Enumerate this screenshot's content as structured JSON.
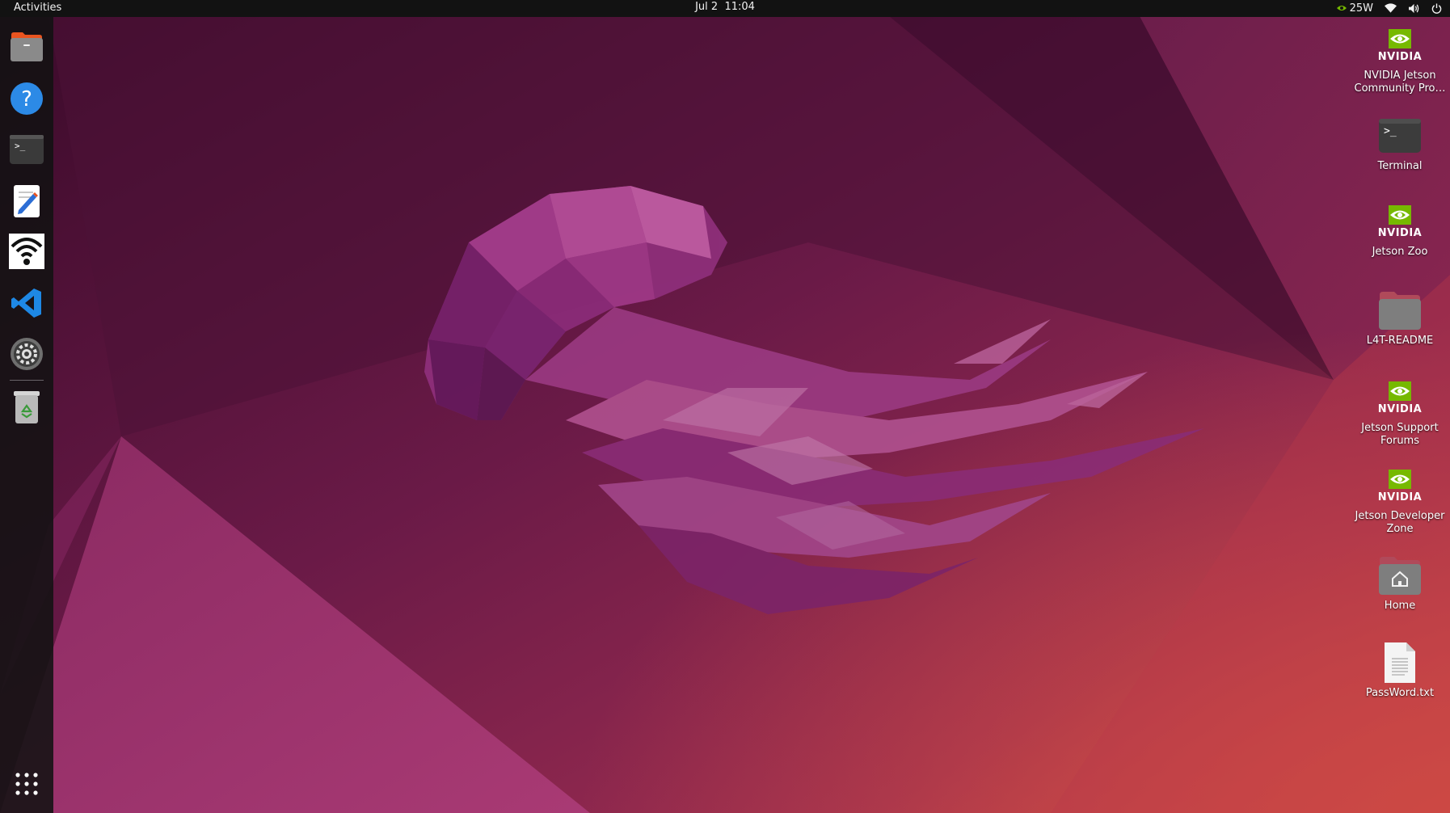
{
  "topbar": {
    "activities_label": "Activities",
    "clock": "Jul 2  11:04",
    "power_mode": "25W",
    "tray_icons": [
      "nvidia-power-mode-icon",
      "wifi-icon",
      "volume-icon",
      "power-icon"
    ]
  },
  "dock": {
    "items": [
      {
        "name": "files",
        "icon": "folder-icon"
      },
      {
        "name": "help",
        "icon": "help-icon"
      },
      {
        "name": "terminal",
        "icon": "terminal-icon"
      },
      {
        "name": "text-editor",
        "icon": "text-editor-icon"
      },
      {
        "name": "wifi-settings",
        "icon": "wifi-icon"
      },
      {
        "name": "vscode",
        "icon": "vscode-icon"
      },
      {
        "name": "settings",
        "icon": "gear-icon"
      },
      {
        "name": "trash",
        "icon": "trash-icon"
      }
    ],
    "show_apps_icon": "app-grid-icon"
  },
  "desktop": {
    "icons": [
      {
        "label": "NVIDIA Jetson Community Pro…",
        "icon": "nvidia-logo-icon"
      },
      {
        "label": "Terminal",
        "icon": "terminal-icon"
      },
      {
        "label": "Jetson Zoo",
        "icon": "nvidia-logo-icon"
      },
      {
        "label": "L4T-README",
        "icon": "folder-icon"
      },
      {
        "label": "Jetson Support Forums",
        "icon": "nvidia-logo-icon"
      },
      {
        "label": "Jetson Developer Zone",
        "icon": "nvidia-logo-icon"
      },
      {
        "label": "Home",
        "icon": "home-folder-icon"
      },
      {
        "label": "PassWord.txt",
        "icon": "text-file-icon"
      }
    ],
    "nvidia_wordmark": "NVIDIA"
  },
  "colors": {
    "topbar_bg": "#121212",
    "dock_bg": "#121212",
    "nvidia_green": "#76b900",
    "wallpaper_dark": "#3a0c2a",
    "wallpaper_orange": "#c7404a"
  }
}
